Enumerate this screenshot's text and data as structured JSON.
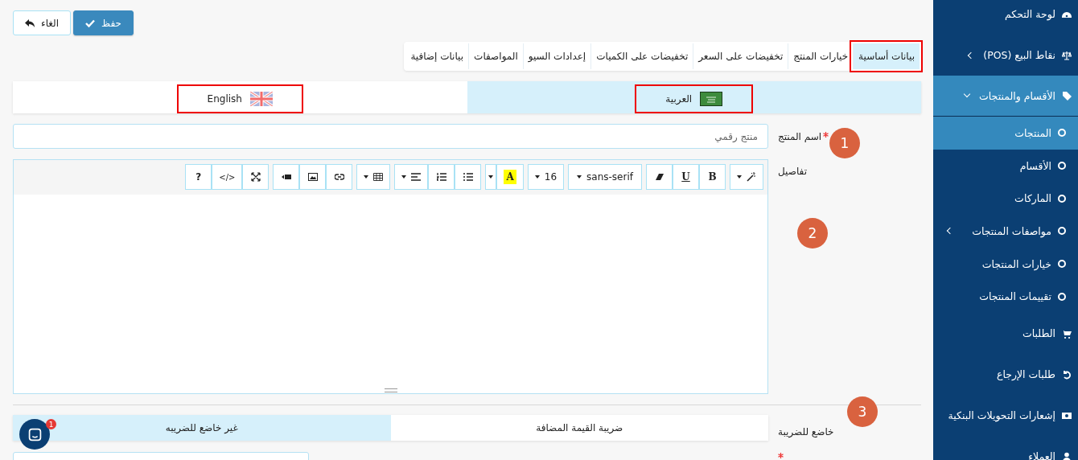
{
  "actions": [
    {
      "kind": "save",
      "label": "حفظ"
    },
    {
      "kind": "cancel",
      "label": "الغاء"
    }
  ],
  "tabs": [
    {
      "label": "بيانات أساسية",
      "selected": true,
      "highlighted": true
    },
    {
      "label": "خيارات المنتج",
      "selected": false,
      "highlighted": false
    },
    {
      "label": "تخفيضات على السعر",
      "selected": false,
      "highlighted": false
    },
    {
      "label": "تخفيضات على الكميات",
      "selected": false,
      "highlighted": false
    },
    {
      "label": "إعدادات السيو",
      "selected": false,
      "highlighted": false
    },
    {
      "label": "المواصفات",
      "selected": false,
      "highlighted": false
    },
    {
      "label": "بيانات إضافية",
      "selected": false,
      "highlighted": false
    }
  ],
  "language_tabs": [
    {
      "kind": "arabic",
      "label": "العربية",
      "selected": true,
      "highlighted": true
    },
    {
      "kind": "english",
      "label": "English",
      "selected": false,
      "highlighted": true
    }
  ],
  "product_name": {
    "label": "اسم المنتج",
    "required": true,
    "placeholder": "منتج رقمي"
  },
  "details": {
    "label": "تفاصيل",
    "toolbar": [
      [
        {
          "kind": "magic"
        }
      ],
      [
        {
          "kind": "bold",
          "label": "B"
        },
        {
          "kind": "underline",
          "label": "U"
        },
        {
          "kind": "eraser"
        }
      ],
      [
        {
          "kind": "font",
          "label": "sans-serif"
        }
      ],
      [
        {
          "kind": "size",
          "label": "16"
        }
      ],
      [
        {
          "kind": "color",
          "label": "A"
        },
        {
          "kind": "caret"
        }
      ],
      [
        {
          "kind": "bullets"
        },
        {
          "kind": "numbers"
        },
        {
          "kind": "align"
        }
      ],
      [
        {
          "kind": "table"
        }
      ],
      [
        {
          "kind": "link"
        },
        {
          "kind": "image"
        },
        {
          "kind": "video"
        }
      ],
      [
        {
          "kind": "fullscreen"
        },
        {
          "kind": "code",
          "label": "</>"
        },
        {
          "kind": "help",
          "label": "?"
        }
      ]
    ]
  },
  "tax": {
    "label": "خاضع للضريبة",
    "options": [
      {
        "label": "ضريبة القيمة المضافة",
        "selected": false
      },
      {
        "label": "غير خاضع للضريبه",
        "selected": true
      }
    ]
  },
  "next_field": {
    "required": true
  },
  "sidebar": {
    "items": [
      {
        "kind": "dashboard",
        "label": "لوحة التحكم"
      },
      {
        "kind": "scale",
        "label": "نقاط البيع (POS)",
        "expanded": false
      },
      {
        "kind": "tag",
        "label": "الأقسام والمنتجات",
        "expanded": true,
        "children": [
          {
            "label": "المنتجات",
            "selected": true
          },
          {
            "label": "الأقسام",
            "selected": false
          },
          {
            "label": "الماركات",
            "selected": false
          },
          {
            "label": "مواصفات المنتجات",
            "selected": false,
            "expanded": false
          },
          {
            "label": "خيارات المنتجات",
            "selected": false
          },
          {
            "label": "تقييمات المنتجات",
            "selected": false
          }
        ]
      },
      {
        "kind": "cart",
        "label": "الطلبات"
      },
      {
        "kind": "undo",
        "label": "طلبات الإرجاع"
      },
      {
        "kind": "money",
        "label": "إشعارات التحويلات البنكية"
      },
      {
        "kind": "user",
        "label": "العملاء"
      }
    ]
  },
  "chat": {
    "badge": "1"
  },
  "annotations": [
    "1",
    "2",
    "3"
  ]
}
